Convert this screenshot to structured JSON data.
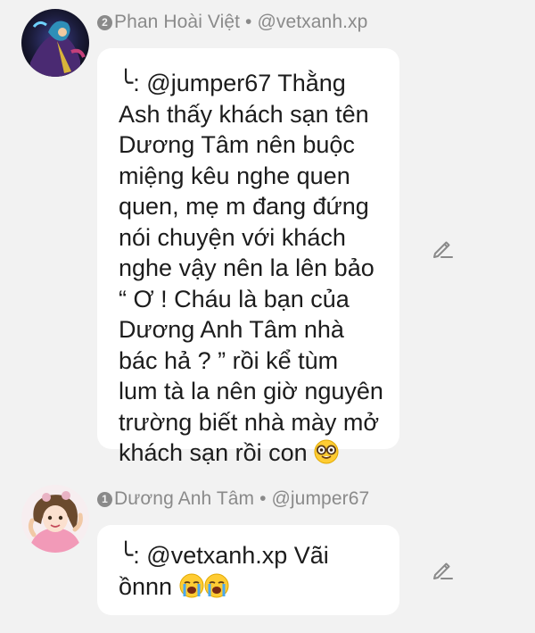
{
  "messages": [
    {
      "rank": "2",
      "author": "Phan Hoài Việt",
      "separator": "•",
      "handle": "@vetxanh.xp",
      "reply_prefix": "╰:",
      "lines": [
        "@jumper67 Thằng",
        "Ash thấy khách sạn tên",
        "Dương Tâm nên buộc",
        "miệng kêu nghe quen",
        "quen, mẹ m đang đứng",
        "nói chuyện với khách",
        "nghe vậy nên la lên bảo",
        "“ Ơ ! Cháu là bạn của",
        "Dương Anh Tâm nhà",
        "bác hả ? ” rồi kể tùm",
        "lum tà la nên giờ nguyên",
        "trường biết nhà mày mở",
        "khách sạn rồi con"
      ],
      "emoji": "nerd-face",
      "avatar": "avatar-dark-character",
      "edit_icon": "pencil-icon"
    },
    {
      "rank": "1",
      "author": "Dương Anh Tâm",
      "separator": "•",
      "handle": "@jumper67",
      "reply_prefix": "╰:",
      "lines": [
        "@vetxanh.xp Vãi",
        "ồnnn"
      ],
      "emoji": "loudly-crying-face x2",
      "avatar": "avatar-anime-girl-pink",
      "edit_icon": "pencil-icon"
    }
  ],
  "colors": {
    "background": "#f2f2f2",
    "bubble": "#ffffff",
    "meta_text": "#8a8a8a",
    "body_text": "#1c1c1c"
  }
}
